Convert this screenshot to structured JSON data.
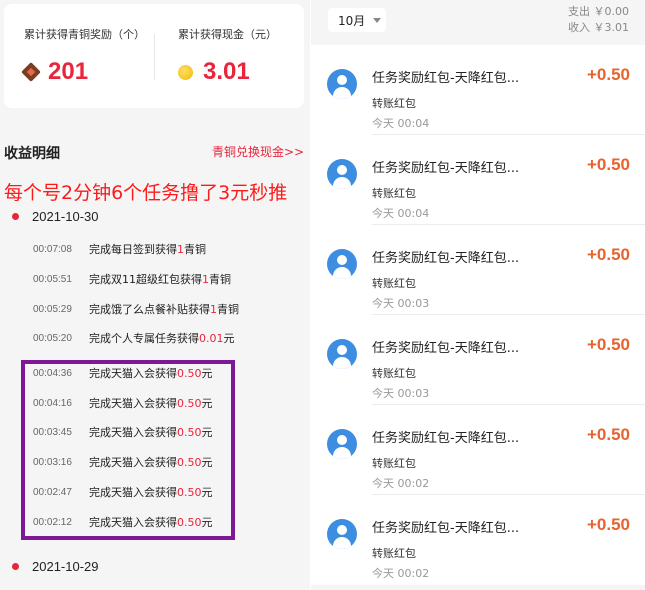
{
  "stats": {
    "copper_label": "累计获得青铜奖励（个）",
    "copper_value": "201",
    "cash_label": "累计获得现金（元）",
    "cash_value": "3.01"
  },
  "income": {
    "title": "收益明细",
    "exchange_link": "青铜兑换现金>>"
  },
  "overlay_caption": "每个号2分钟6个任务撸了3元秒推",
  "dates": [
    "2021-10-30",
    "2021-10-29"
  ],
  "records": [
    {
      "time": "00:07:08",
      "text": "完成每日签到获得",
      "amount": "1",
      "unit": "青铜"
    },
    {
      "time": "00:05:51",
      "text": "完成双11超级红包获得",
      "amount": "1",
      "unit": "青铜"
    },
    {
      "time": "00:05:29",
      "text": "完成饿了么点餐补贴获得",
      "amount": "1",
      "unit": "青铜"
    },
    {
      "time": "00:05:20",
      "text": "完成个人专属任务获得",
      "amount": "0.01",
      "unit": "元"
    },
    {
      "time": "00:04:36",
      "text": "完成天猫入会获得",
      "amount": "0.50",
      "unit": "元"
    },
    {
      "time": "00:04:16",
      "text": "完成天猫入会获得",
      "amount": "0.50",
      "unit": "元"
    },
    {
      "time": "00:03:45",
      "text": "完成天猫入会获得",
      "amount": "0.50",
      "unit": "元"
    },
    {
      "time": "00:03:16",
      "text": "完成天猫入会获得",
      "amount": "0.50",
      "unit": "元"
    },
    {
      "time": "00:02:47",
      "text": "完成天猫入会获得",
      "amount": "0.50",
      "unit": "元"
    },
    {
      "time": "00:02:12",
      "text": "完成天猫入会获得",
      "amount": "0.50",
      "unit": "元"
    }
  ],
  "wallet": {
    "month": "10月",
    "expense": "支出 ￥0.00",
    "income": "收入 ￥3.01"
  },
  "transactions": [
    {
      "title": "任务奖励红包-天降红包...",
      "sub": "转账红包",
      "time": "今天  00:04",
      "amount": "+0.50"
    },
    {
      "title": "任务奖励红包-天降红包...",
      "sub": "转账红包",
      "time": "今天  00:04",
      "amount": "+0.50"
    },
    {
      "title": "任务奖励红包-天降红包...",
      "sub": "转账红包",
      "time": "今天  00:03",
      "amount": "+0.50"
    },
    {
      "title": "任务奖励红包-天降红包...",
      "sub": "转账红包",
      "time": "今天  00:03",
      "amount": "+0.50"
    },
    {
      "title": "任务奖励红包-天降红包...",
      "sub": "转账红包",
      "time": "今天  00:02",
      "amount": "+0.50"
    },
    {
      "title": "任务奖励红包-天降红包...",
      "sub": "转账红包",
      "time": "今天  00:02",
      "amount": "+0.50"
    }
  ],
  "colors": {
    "accent_red": "#e8253b",
    "amount_orange": "#e8622d",
    "highlight_box": "#7d1896",
    "avatar_blue": "#3d8ee0"
  },
  "icons": {
    "copper": "copper-diamond-icon",
    "cash": "gold-coin-icon",
    "avatar": "user-avatar-icon",
    "month_caret": "caret-down-icon"
  }
}
